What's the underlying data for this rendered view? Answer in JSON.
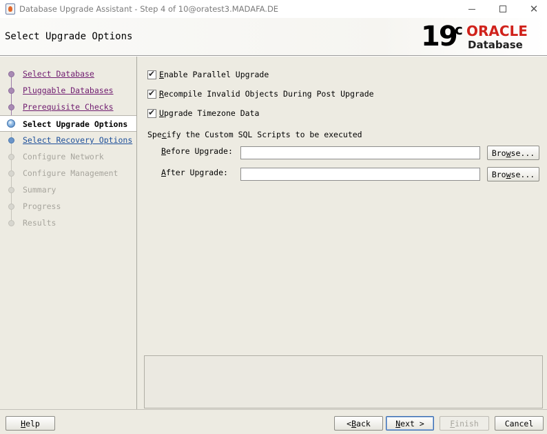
{
  "window": {
    "title": "Database Upgrade Assistant - Step 4 of 10@oratest3.MADAFA.DE",
    "minimize_icon": "minimize-icon",
    "maximize_icon": "maximize-icon",
    "close_icon": "close-icon",
    "close_glyph": "✕"
  },
  "header": {
    "title": "Select Upgrade Options",
    "logo_version": "19",
    "logo_version_sup": "c",
    "logo_brand": "ORACLE",
    "logo_product": "Database",
    "brand_color": "#d0221b"
  },
  "steps": [
    {
      "label": "Select Database",
      "state": "done"
    },
    {
      "label": "Pluggable Databases",
      "state": "done"
    },
    {
      "label": "Prerequisite Checks",
      "state": "done"
    },
    {
      "label": "Select Upgrade Options",
      "state": "current"
    },
    {
      "label": "Select Recovery Options",
      "state": "todo"
    },
    {
      "label": "Configure Network",
      "state": "disabled"
    },
    {
      "label": "Configure Management",
      "state": "disabled"
    },
    {
      "label": "Summary",
      "state": "disabled"
    },
    {
      "label": "Progress",
      "state": "disabled"
    },
    {
      "label": "Results",
      "state": "disabled"
    }
  ],
  "options": {
    "parallel": {
      "first": "E",
      "rest": "nable Parallel Upgrade",
      "checked": true
    },
    "recompile": {
      "first": "R",
      "rest": "ecompile Invalid Objects During Post Upgrade",
      "checked": true
    },
    "timezone": {
      "first": "U",
      "rest": "pgrade Timezone Data",
      "checked": true
    },
    "check_glyph": "✔"
  },
  "scripts": {
    "section_a": "Spe",
    "section_u": "c",
    "section_b": "ify the Custom SQL Scripts to be executed",
    "before": {
      "first": "B",
      "rest": "efore Upgrade:",
      "value": ""
    },
    "after": {
      "first": "A",
      "rest": "fter Upgrade:",
      "value": ""
    },
    "browse_a": "Bro",
    "browse_u": "w",
    "browse_b": "se..."
  },
  "footer": {
    "help_first": "H",
    "help_rest": "elp",
    "back_pre": "< ",
    "back_first": "B",
    "back_rest": "ack",
    "next_first": "N",
    "next_rest": "ext >",
    "finish_first": "F",
    "finish_rest": "inish",
    "cancel": "Cancel"
  }
}
